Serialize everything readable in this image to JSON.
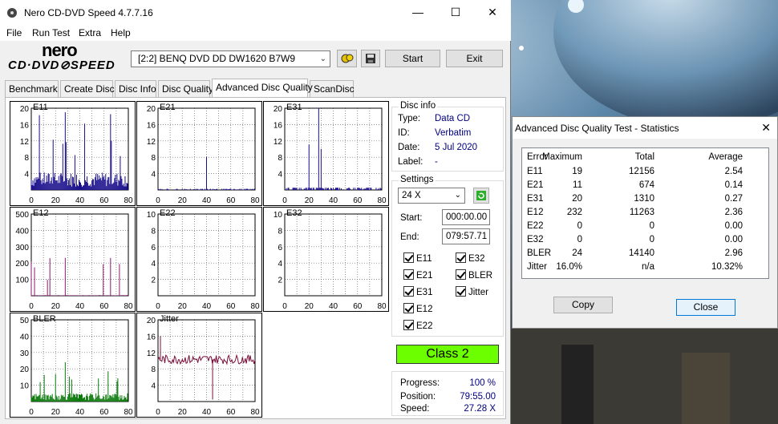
{
  "window": {
    "title": "Nero CD-DVD Speed 4.7.7.16",
    "minimize": "—",
    "maximize": "☐",
    "close": "✕"
  },
  "menu": [
    "File",
    "Run Test",
    "Extra",
    "Help"
  ],
  "logo": {
    "line1": "nero",
    "line2": "CD·DVD⊘SPEED"
  },
  "drive": {
    "value": "[2:2]   BENQ DVD DD DW1620 B7W9"
  },
  "buttons": {
    "start": "Start",
    "exit": "Exit"
  },
  "tabs": [
    "Benchmark",
    "Create Disc",
    "Disc Info",
    "Disc Quality",
    "Advanced Disc Quality",
    "ScanDisc"
  ],
  "active_tab": "Advanced Disc Quality",
  "disc_info": {
    "title": "Disc info",
    "type_label": "Type:",
    "type": "Data CD",
    "id_label": "ID:",
    "id": "Verbatim",
    "date_label": "Date:",
    "date": "5 Jul 2020",
    "label_label": "Label:",
    "label": "-"
  },
  "settings": {
    "title": "Settings",
    "speed": "24 X",
    "start_label": "Start:",
    "start": "000:00.00",
    "end_label": "End:",
    "end": "079:57.71",
    "checks": [
      "E11",
      "E32",
      "E21",
      "BLER",
      "E31",
      "Jitter",
      "E12",
      "E22"
    ]
  },
  "class": "Class 2",
  "progress": {
    "progress_label": "Progress:",
    "progress": "100 %",
    "position_label": "Position:",
    "position": "79:55.00",
    "speed_label": "Speed:",
    "speed": "27.28 X"
  },
  "stats": {
    "title": "Advanced Disc Quality Test - Statistics",
    "close_x": "✕",
    "headers": [
      "Error",
      "Maximum",
      "Total",
      "Average"
    ],
    "rows": [
      {
        "name": "E11",
        "max": "19",
        "total": "12156",
        "avg": "2.54"
      },
      {
        "name": "E21",
        "max": "11",
        "total": "674",
        "avg": "0.14"
      },
      {
        "name": "E31",
        "max": "20",
        "total": "1310",
        "avg": "0.27"
      },
      {
        "name": "E12",
        "max": "232",
        "total": "11263",
        "avg": "2.36"
      },
      {
        "name": "E22",
        "max": "0",
        "total": "0",
        "avg": "0.00"
      },
      {
        "name": "E32",
        "max": "0",
        "total": "0",
        "avg": "0.00"
      },
      {
        "name": "BLER",
        "max": "24",
        "total": "14140",
        "avg": "2.96"
      },
      {
        "name": "Jitter",
        "max": "16.0%",
        "total": "n/a",
        "avg": "10.32%"
      }
    ],
    "copy": "Copy",
    "close": "Close"
  },
  "colors": {
    "highlight_green": "#00ff00",
    "bler_green": "#9cff00",
    "blue_series": "#1a0f8c",
    "purple_series": "#8a1a6e",
    "green_series": "#0a7a0a",
    "jitter_series": "#7a0f3a"
  },
  "chart_data": [
    {
      "type": "bar",
      "title": "E11",
      "xlim": [
        0,
        80
      ],
      "ylim": [
        0,
        20
      ],
      "yticks": [
        "20",
        "16",
        "12",
        "8",
        "4"
      ],
      "xticks": [
        "0",
        "20",
        "40",
        "60",
        "80"
      ],
      "series_color": "blue",
      "max": 19,
      "avg": 2.54
    },
    {
      "type": "bar",
      "title": "E21",
      "xlim": [
        0,
        80
      ],
      "ylim": [
        0,
        20
      ],
      "yticks": [
        "20",
        "16",
        "12",
        "8",
        "4"
      ],
      "xticks": [
        "0",
        "20",
        "40",
        "60",
        "80"
      ],
      "series_color": "blue",
      "max": 11,
      "avg": 0.14
    },
    {
      "type": "bar",
      "title": "E31",
      "xlim": [
        0,
        80
      ],
      "ylim": [
        0,
        20
      ],
      "yticks": [
        "20",
        "16",
        "12",
        "8",
        "4"
      ],
      "xticks": [
        "0",
        "20",
        "40",
        "60",
        "80"
      ],
      "series_color": "blue",
      "max": 20,
      "avg": 0.27
    },
    {
      "type": "bar",
      "title": "E12",
      "xlim": [
        0,
        80
      ],
      "ylim": [
        0,
        500
      ],
      "yticks": [
        "500",
        "400",
        "300",
        "200",
        "100"
      ],
      "xticks": [
        "0",
        "20",
        "40",
        "60",
        "80"
      ],
      "series_color": "purple",
      "max": 232,
      "avg": 2.36
    },
    {
      "type": "bar",
      "title": "E22",
      "xlim": [
        0,
        80
      ],
      "ylim": [
        0,
        10
      ],
      "yticks": [
        "10",
        "8",
        "6",
        "4",
        "2"
      ],
      "xticks": [
        "0",
        "20",
        "40",
        "60",
        "80"
      ],
      "series_color": "purple",
      "max": 0,
      "avg": 0
    },
    {
      "type": "bar",
      "title": "E32",
      "xlim": [
        0,
        80
      ],
      "ylim": [
        0,
        10
      ],
      "yticks": [
        "10",
        "8",
        "6",
        "4",
        "2"
      ],
      "xticks": [
        "0",
        "20",
        "40",
        "60",
        "80"
      ],
      "series_color": "purple",
      "max": 0,
      "avg": 0
    },
    {
      "type": "bar",
      "title": "BLER",
      "xlim": [
        0,
        80
      ],
      "ylim": [
        0,
        50
      ],
      "yticks": [
        "50",
        "40",
        "30",
        "20",
        "10"
      ],
      "xticks": [
        "0",
        "20",
        "40",
        "60",
        "80"
      ],
      "series_color": "green",
      "max": 24,
      "avg": 2.96
    },
    {
      "type": "line",
      "title": "Jitter",
      "xlim": [
        0,
        80
      ],
      "ylim": [
        0,
        20
      ],
      "yticks": [
        "20",
        "16",
        "12",
        "8",
        "4"
      ],
      "xticks": [
        "0",
        "20",
        "40",
        "60",
        "80"
      ],
      "series_color": "jitter",
      "max": 16.0,
      "avg": 10.32
    }
  ]
}
